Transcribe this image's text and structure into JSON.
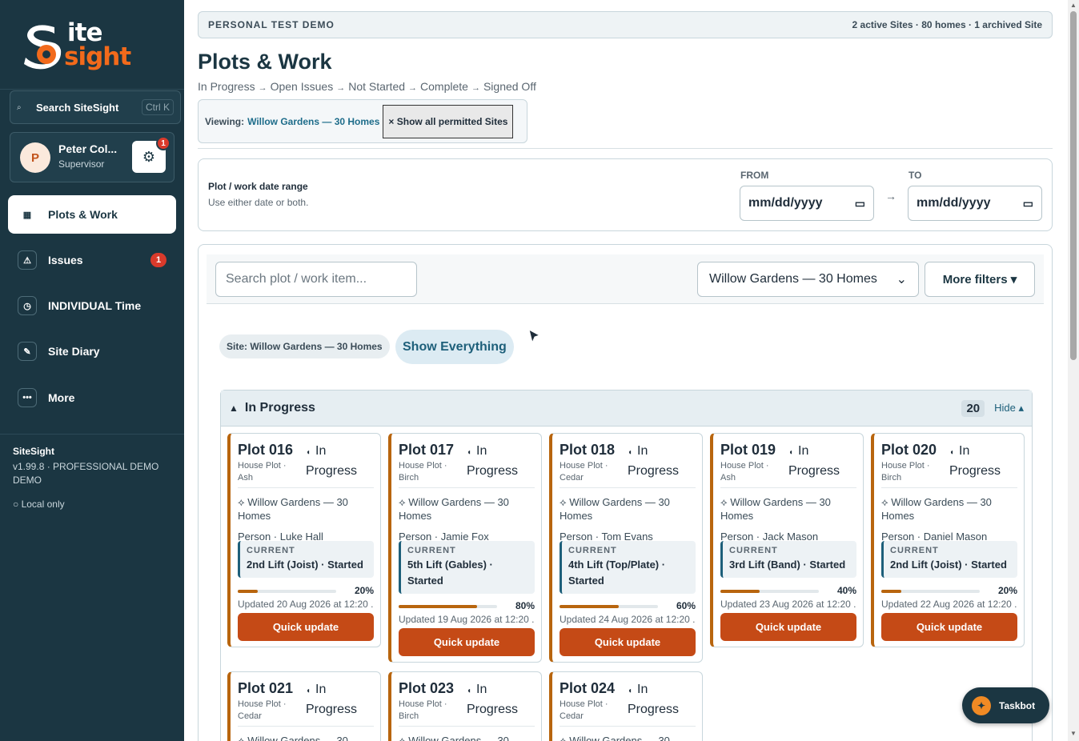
{
  "app": {
    "logo_line1": "ite",
    "logo_line2": "sight",
    "logo_alt": "SiteSight"
  },
  "sidebar": {
    "search_label": "Search SiteSight",
    "search_shortcut": "Ctrl K",
    "user": {
      "initial": "P",
      "name": "Peter Col...",
      "role": "Supervisor",
      "settings_badge": "1"
    },
    "items": [
      {
        "label": "Plots & Work",
        "icon": "grid-icon",
        "active": true
      },
      {
        "label": "Issues",
        "icon": "warning-icon",
        "badge": "1"
      },
      {
        "label": "INDIVIDUAL Time",
        "icon": "clock-icon"
      },
      {
        "label": "Site Diary",
        "icon": "pencil-icon"
      },
      {
        "label": "More",
        "icon": "more-icon"
      }
    ],
    "footer": {
      "name": "SiteSight",
      "version": "v1.99.8 · PROFESSIONAL DEMO DEMO",
      "storage": "○ Local only"
    }
  },
  "topbar": {
    "left": "PERSONAL TEST DEMO",
    "right": "2 active Sites · 80 homes · 1 archived Site"
  },
  "page": {
    "title": "Plots & Work",
    "flow": [
      "In Progress",
      "Open Issues",
      "Not Started",
      "Complete",
      "Signed Off"
    ],
    "flow_arrow": "→",
    "viewing_label": "Viewing:",
    "viewing_site": "Willow Gardens — 30 Homes",
    "show_all_button": "× Show all permitted Sites"
  },
  "date_range": {
    "title": "Plot / work date range",
    "subtitle": "Use either date or both.",
    "from_label": "FROM",
    "to_label": "TO",
    "from_placeholder": "mm/dd/yyyy",
    "to_placeholder": "mm/dd/yyyy",
    "arrow": "→"
  },
  "filters": {
    "search_placeholder": "Search plot / work item...",
    "site_selected": "Willow Gardens — 30 Homes",
    "more_filters": "More filters ▾",
    "chip_site": "Site: Willow Gardens — 30 Homes",
    "chip_all": "Show Everything"
  },
  "group": {
    "icon": "▲",
    "title": "In Progress",
    "count": "20",
    "hide": "Hide ▴"
  },
  "cards": [
    {
      "plot": "Plot 016",
      "type": "House Plot · Ash",
      "status": "In Progress",
      "site": "⟡ Willow Gardens — 30 Homes",
      "person": "Person · Luke Hall",
      "current_label": "CURRENT",
      "current": "2nd Lift (Joist) · Started",
      "progress": 0.2,
      "pct": "20%",
      "updated": "Updated 20 Aug 2026 at 12:20 ...",
      "button": "Quick update"
    },
    {
      "plot": "Plot 017",
      "type": "House Plot · Birch",
      "status": "In Progress",
      "site": "⟡ Willow Gardens — 30 Homes",
      "person": "Person · Jamie Fox",
      "current_label": "CURRENT",
      "current": "5th Lift (Gables) · Started",
      "progress": 0.8,
      "pct": "80%",
      "updated": "Updated 19 Aug 2026 at 12:20 ...",
      "button": "Quick update"
    },
    {
      "plot": "Plot 018",
      "type": "House Plot · Cedar",
      "status": "In Progress",
      "site": "⟡ Willow Gardens — 30 Homes",
      "person": "Person · Tom Evans",
      "current_label": "CURRENT",
      "current": "4th Lift (Top/Plate) · Started",
      "progress": 0.6,
      "pct": "60%",
      "updated": "Updated 24 Aug 2026 at 12:20 ...",
      "button": "Quick update"
    },
    {
      "plot": "Plot 019",
      "type": "House Plot · Ash",
      "status": "In Progress",
      "site": "⟡ Willow Gardens — 30 Homes",
      "person": "Person · Jack Mason",
      "current_label": "CURRENT",
      "current": "3rd Lift (Band) · Started",
      "progress": 0.4,
      "pct": "40%",
      "updated": "Updated 23 Aug 2026 at 12:20 ...",
      "button": "Quick update"
    },
    {
      "plot": "Plot 020",
      "type": "House Plot · Birch",
      "status": "In Progress",
      "site": "⟡ Willow Gardens — 30 Homes",
      "person": "Person · Daniel Mason",
      "current_label": "CURRENT",
      "current": "2nd Lift (Joist) · Started",
      "progress": 0.2,
      "pct": "20%",
      "updated": "Updated 22 Aug 2026 at 12:20 ...",
      "button": "Quick update"
    },
    {
      "plot": "Plot 021",
      "type": "House Plot · Cedar",
      "status": "In Progress",
      "site": "⟡ Willow Gardens — 30"
    },
    {
      "plot": "Plot 023",
      "type": "House Plot · Birch",
      "status": "In Progress",
      "site": "⟡ Willow Gardens — 30"
    },
    {
      "plot": "Plot 024",
      "type": "House Plot · Cedar",
      "status": "In Progress",
      "site": "⟡ Willow Gardens — 30"
    }
  ],
  "taskbot": {
    "label": "Taskbot"
  }
}
